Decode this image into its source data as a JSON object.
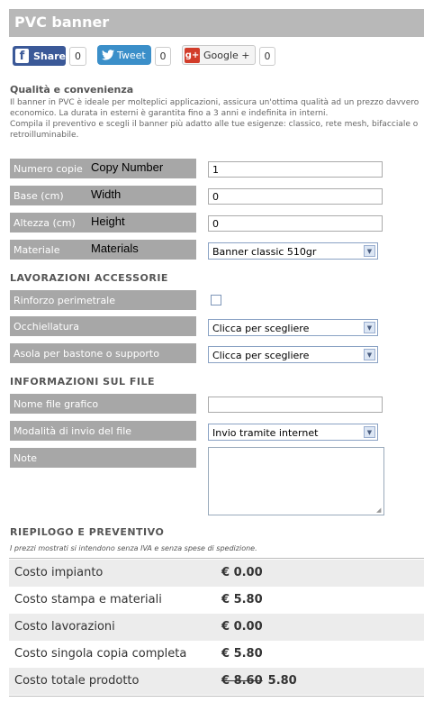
{
  "header": {
    "title": "PVC banner"
  },
  "social": {
    "facebook_label": "Share",
    "facebook_count": "0",
    "twitter_label": "Tweet",
    "twitter_count": "0",
    "google_label": "Google +",
    "google_count": "0"
  },
  "intro": {
    "heading": "Qualità e convenienza",
    "text1": "Il banner in PVC è ideale per molteplici applicazioni, assicura un'ottima qualità ad un prezzo davvero economico. La durata in esterni è garantita fino a 3 anni e indefinita in interni.",
    "text2": "Compila il preventivo e scegli il banner più adatto alle tue esigenze: classico, rete mesh, bifacciale o retroilluminabile."
  },
  "form": {
    "copies": {
      "label": "Numero copie",
      "en": "Copy Number",
      "value": "1"
    },
    "width": {
      "label": "Base (cm)",
      "en": "Width",
      "value": "0"
    },
    "height": {
      "label": "Altezza (cm)",
      "en": "Height",
      "value": "0"
    },
    "material": {
      "label": "Materiale",
      "en": "Materials",
      "value": "Banner classic 510gr"
    }
  },
  "accessories": {
    "title": "LAVORAZIONI ACCESSORIE",
    "reinforce_label": "Rinforzo perimetrale",
    "eyelets_label": "Occhiellatura",
    "eyelets_value": "Clicca per scegliere",
    "pocket_label": "Asola per bastone o supporto",
    "pocket_value": "Clicca per scegliere"
  },
  "file": {
    "title": "INFORMAZIONI SUL FILE",
    "name_label": "Nome file grafico",
    "mode_label": "Modalità di invio del file",
    "mode_value": "Invio tramite internet",
    "notes_label": "Note"
  },
  "summary": {
    "title": "RIEPILOGO E PREVENTIVO",
    "note": "I prezzi mostrati si intendono senza IVA e senza spese di spedizione.",
    "rows": [
      {
        "label": "Costo impianto",
        "value": "€ 0.00"
      },
      {
        "label": "Costo stampa e materiali",
        "value": "€ 5.80"
      },
      {
        "label": "Costo lavorazioni",
        "value": "€ 0.00"
      },
      {
        "label": "Costo singola copia completa",
        "value": "€ 5.80"
      },
      {
        "label": "Costo totale prodotto",
        "old_value": "€ 8.60",
        "value": "5.80"
      }
    ]
  }
}
